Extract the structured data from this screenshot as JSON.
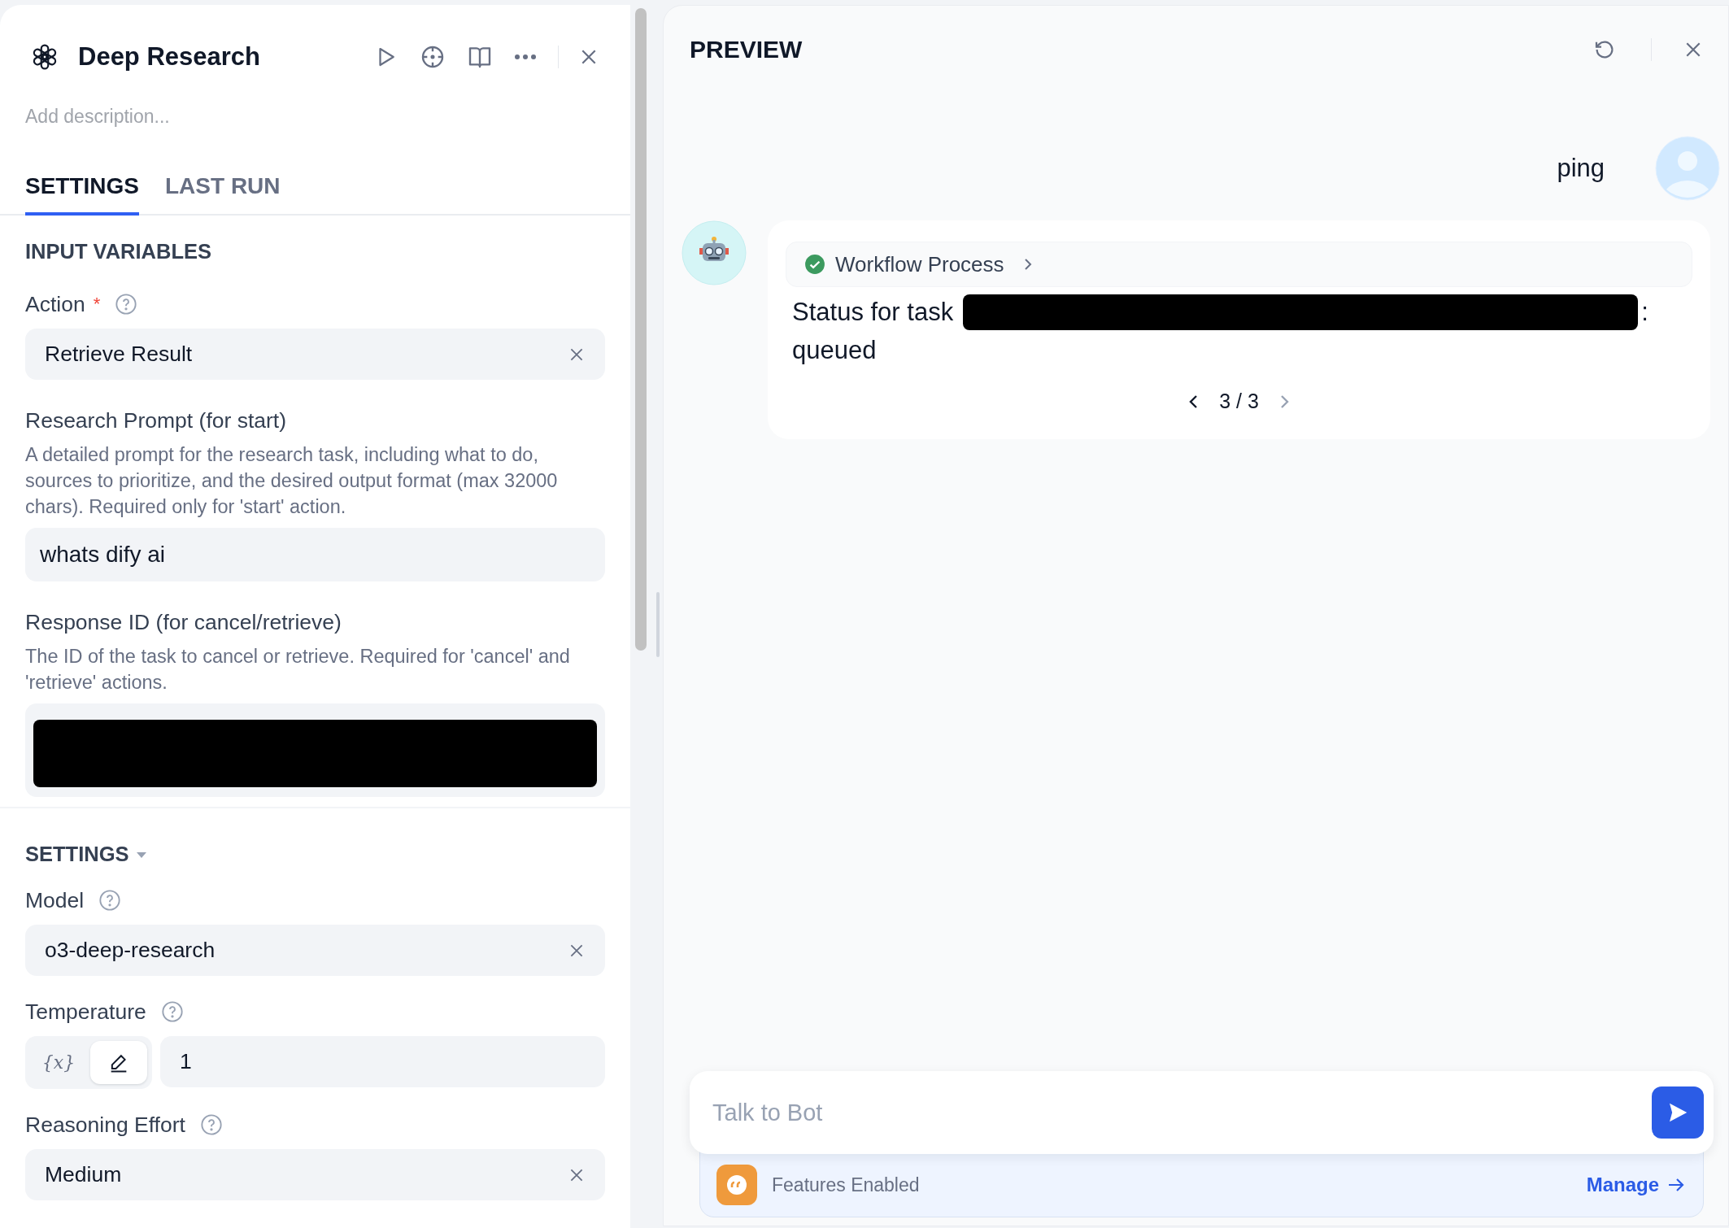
{
  "node": {
    "title": "Deep Research",
    "description": {
      "placeholder": "Add description..."
    },
    "tabs": [
      {
        "label": "SETTINGS",
        "selected": true
      },
      {
        "label": "LAST RUN",
        "selected": false
      }
    ],
    "input_section": {
      "title": "INPUT VARIABLES"
    },
    "inputs": [
      {
        "kind": "select",
        "label": "Action",
        "required_mark": "*",
        "help": true,
        "value": "Retrieve Result"
      },
      {
        "kind": "text",
        "label": "Research Prompt (for start)",
        "description": "A detailed prompt for the research task, including what to do, sources to prioritize, and the desired output format (max 32000 chars). Required only for 'start' action.",
        "value": "whats dify ai"
      },
      {
        "kind": "redacted",
        "label": "Response ID (for cancel/retrieve)",
        "description": "The ID of the task to cancel or retrieve. Required for 'cancel' and 'retrieve' actions."
      }
    ],
    "settings_section": {
      "title": "SETTINGS",
      "expanded": true
    },
    "settings": [
      {
        "kind": "select",
        "label": "Model",
        "help": true,
        "value": "o3-deep-research"
      },
      {
        "kind": "number",
        "label": "Temperature",
        "help": true,
        "value": "1",
        "modes": [
          {
            "kind": "variable",
            "label": "{x}",
            "selected": false
          },
          {
            "kind": "constant",
            "selected": true
          }
        ]
      },
      {
        "kind": "select",
        "label": "Reasoning Effort",
        "help": true,
        "value": "Medium"
      }
    ]
  },
  "preview": {
    "title": "PREVIEW",
    "messages": [
      {
        "kind": "user",
        "text": "ping"
      },
      {
        "kind": "bot",
        "process": {
          "label": "Workflow Process",
          "succeeded": true
        },
        "status_text": "Status for task",
        "status_suffix": ":",
        "status_value": "queued",
        "pager": {
          "text": "3 / 3",
          "prev_disabled": false,
          "next_disabled": true
        }
      }
    ],
    "input": {
      "placeholder": "Talk to Bot"
    },
    "features": {
      "label": "Features Enabled",
      "link": "Manage"
    }
  }
}
